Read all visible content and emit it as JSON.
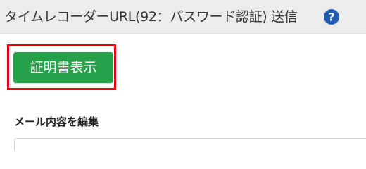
{
  "header": {
    "title": "タイムレコーダーURL(92：パスワード認証) 送信",
    "help_icon": "question-circle-icon",
    "help_icon_color": "#1f5bb0"
  },
  "main": {
    "certificate_button_label": "証明書表示",
    "certificate_button_color": "#27a04a",
    "highlight_color": "#e60012",
    "edit_mail_label": "メール内容を編集"
  }
}
